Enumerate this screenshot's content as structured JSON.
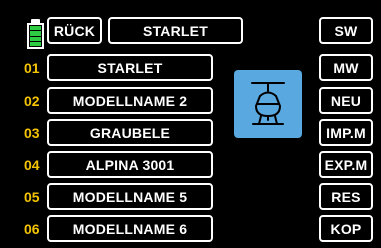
{
  "header": {
    "back_label": "RÜCK",
    "current_model": "STARLET"
  },
  "battery": {
    "icon": "battery-icon",
    "level": 1.0,
    "color": "#2ecc40"
  },
  "model_list": [
    {
      "number": "01",
      "name": "STARLET"
    },
    {
      "number": "02",
      "name": "MODELLNAME 2"
    },
    {
      "number": "03",
      "name": "GRAUBELE"
    },
    {
      "number": "04",
      "name": "ALPINA 3001"
    },
    {
      "number": "05",
      "name": "MODELLNAME 5"
    },
    {
      "number": "06",
      "name": "MODELLNAME 6"
    }
  ],
  "model_preview": {
    "icon": "helicopter-icon",
    "background": "#59a8e0"
  },
  "side_menu": {
    "sw": "SW",
    "mw": "MW",
    "neu": "NEU",
    "imp": "IMP.M",
    "exp": "EXP.M",
    "res": "RES",
    "kop": "KOP"
  },
  "colors": {
    "row_number": "#f5c400",
    "outline": "#ffffff",
    "background": "#000000"
  }
}
